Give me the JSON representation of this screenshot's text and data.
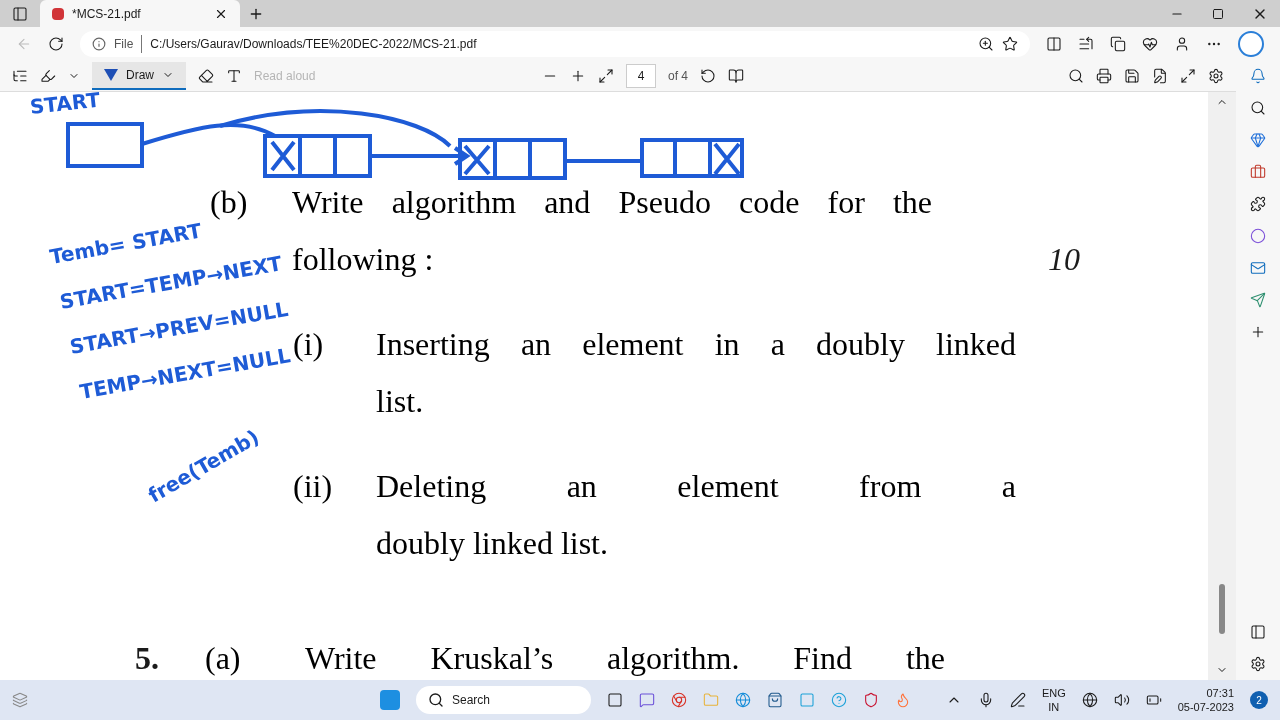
{
  "tabs": [
    {
      "title": "*MCS-21.pdf",
      "selected": true
    }
  ],
  "address": {
    "scheme": "File",
    "url": "C:/Users/Gaurav/Downloads/TEE%20DEC-2022/MCS-21.pdf"
  },
  "pdf_toolbar": {
    "draw_label": "Draw",
    "draw_active": true,
    "read_aloud": "Read aloud",
    "read_aloud_disabled": true,
    "page": "4",
    "page_count": "of 4"
  },
  "document": {
    "blocks": [
      {
        "kind": "sub",
        "label": "(b)",
        "lines": [
          "Write algorithm and Pseudo code for the",
          "following :"
        ],
        "marks": "10"
      },
      {
        "kind": "item",
        "label": "(i)",
        "lines": [
          "Inserting an element in a doubly linked",
          "list."
        ]
      },
      {
        "kind": "item",
        "label": "(ii)",
        "lines": [
          "Deleting an element from a",
          "doubly linked list."
        ]
      },
      {
        "kind": "question",
        "number": "5.",
        "label": "(a)",
        "lines": [
          "Write Kruskal’s algorithm. Find the"
        ]
      }
    ]
  },
  "ink": [
    "START",
    "Temb= START",
    "START=TEMP→NEXT",
    "START→PREV=NULL",
    "TEMP→NEXT=NULL",
    "free(Temb)"
  ],
  "taskbar": {
    "search": "Search",
    "lang": "ENG",
    "region": "IN",
    "time": "07:31",
    "date": "05-07-2023",
    "notifications": "2"
  }
}
